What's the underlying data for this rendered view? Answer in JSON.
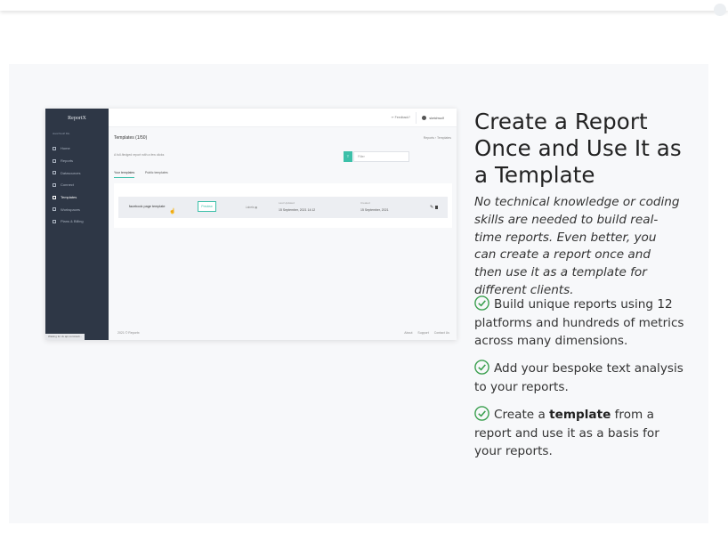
{
  "section": {
    "heading": "Create a Report Once and Use It as a Template",
    "lead": "No technical knowledge or coding skills are needed to build real-time reports. Even better, you can create a report once and then use it as a template for different clients.",
    "bullets": [
      {
        "text": "Build unique reports using 12 platforms and hundreds of metrics across many dimensions."
      },
      {
        "text": "Add your bespoke text analysis to your reports."
      },
      {
        "pre": "Create a ",
        "bold": "template",
        "post": " from a report and use it as a basis for your reports."
      }
    ],
    "check_color": "#3a9f4e"
  },
  "app": {
    "logo": "ReportX",
    "account": "sketchwolf fille",
    "nav": [
      "Home",
      "Reports",
      "Datasources",
      "Connect",
      "Templates",
      "Workspaces",
      "Plans & Billing"
    ],
    "active_nav": "Templates",
    "loading": "Waiting for vk.api.com/web...",
    "header": {
      "feedback": "✏ Feedback?",
      "user": "sketchwolf"
    },
    "page_title": "Templates (1/50)",
    "breadcrumb": "Reports  ›  Templates",
    "subtitle": "A full-fledged report with a few clicks",
    "filter_button": "T",
    "filter_placeholder": "Filter",
    "tabs": [
      "Your templates",
      "Public templates"
    ],
    "row": {
      "name": "facebook page template",
      "preview": "Preview",
      "labels": "Labels",
      "last_updated_label": "Last Updated",
      "last_updated": "15 September, 2021 14:12",
      "created_label": "Created",
      "created": "15 September, 2021"
    },
    "footer": {
      "copyright": "2021 © Reportx",
      "links": [
        "About",
        "Support",
        "Contact Us"
      ]
    },
    "accent_color": "#3cc0a9"
  }
}
